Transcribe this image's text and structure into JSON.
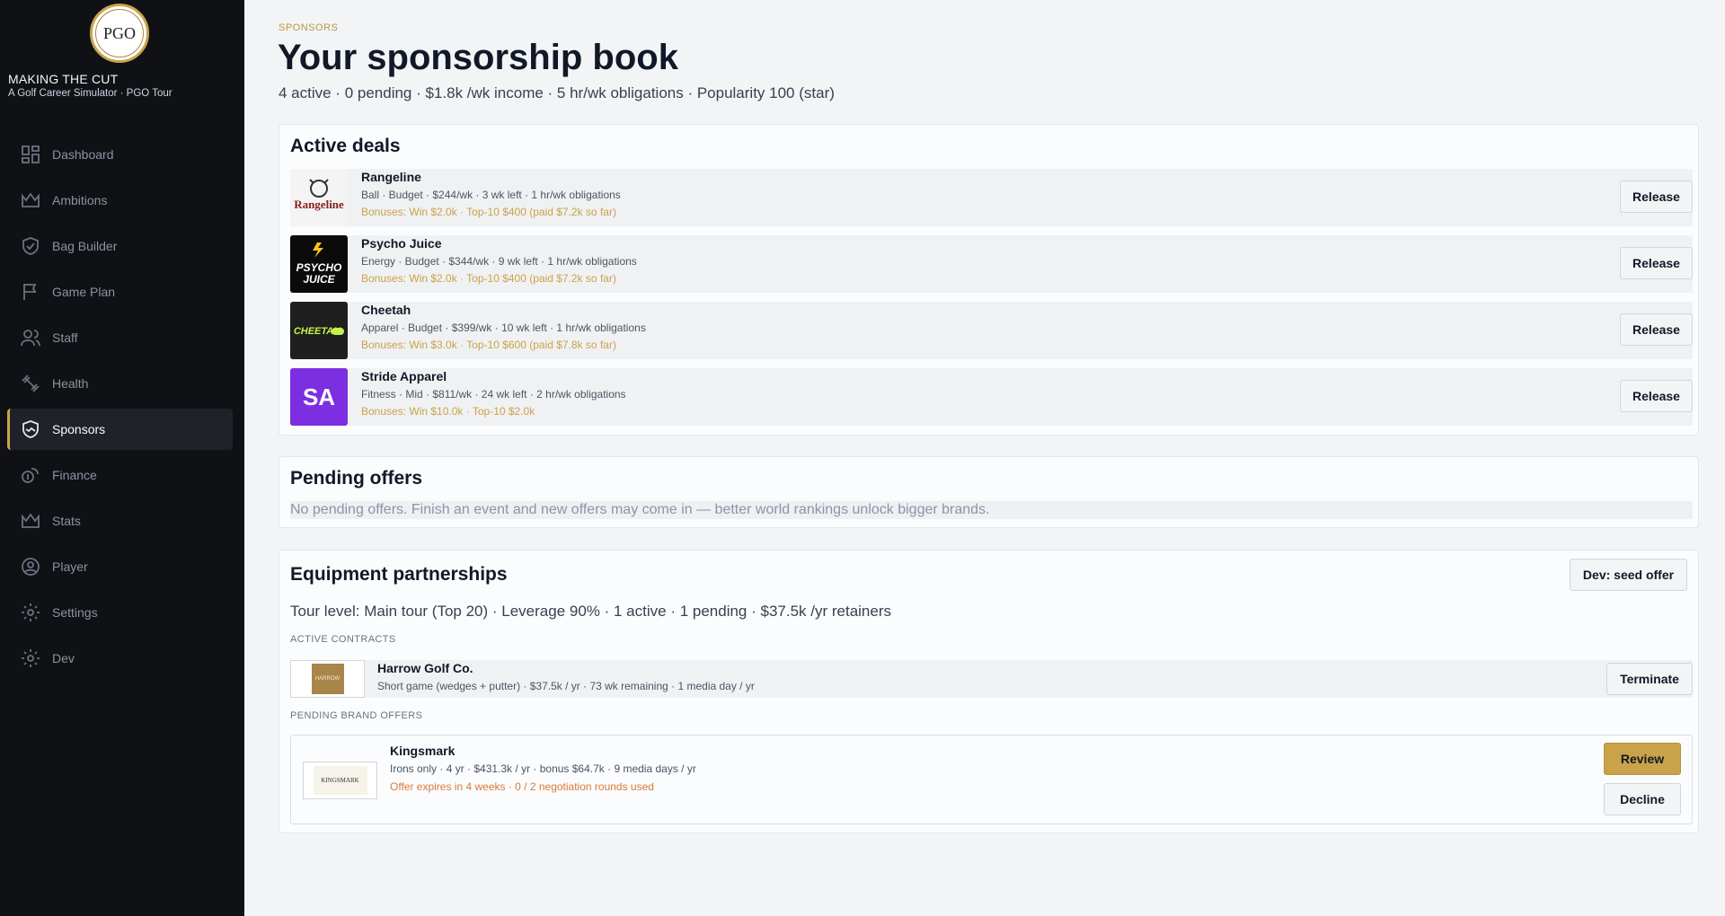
{
  "brand": {
    "logo_text": "PGO",
    "title": "MAKING THE CUT",
    "subtitle": "A Golf Career Simulator · PGO Tour"
  },
  "nav": [
    {
      "label": "Dashboard",
      "icon": "dashboard-icon"
    },
    {
      "label": "Ambitions",
      "icon": "crown-icon"
    },
    {
      "label": "Bag Builder",
      "icon": "shield-icon"
    },
    {
      "label": "Game Plan",
      "icon": "flag-icon"
    },
    {
      "label": "Staff",
      "icon": "users-icon"
    },
    {
      "label": "Health",
      "icon": "dumbbell-icon"
    },
    {
      "label": "Sponsors",
      "icon": "handshake-icon",
      "active": true
    },
    {
      "label": "Finance",
      "icon": "coins-icon"
    },
    {
      "label": "Stats",
      "icon": "crown-icon"
    },
    {
      "label": "Player",
      "icon": "user-circle-icon"
    },
    {
      "label": "Settings",
      "icon": "gear-icon"
    },
    {
      "label": "Dev",
      "icon": "gear-icon"
    }
  ],
  "header": {
    "eyebrow": "SPONSORS",
    "title": "Your sponsorship book",
    "summary": "4 active · 0 pending · $1.8k /wk income · 5 hr/wk obligations · Popularity 100 (star)"
  },
  "active_deals": {
    "title": "Active deals",
    "release_label": "Release",
    "deals": [
      {
        "name": "Rangeline",
        "logo_text": "Rangeline",
        "meta": "Ball · Budget · $244/wk · 3 wk left · 1 hr/wk obligations",
        "bonus": "Bonuses: Win $2.0k · Top-10 $400  (paid $7.2k so far)"
      },
      {
        "name": "Psycho Juice",
        "logo_text": "PSYCHO JUICE",
        "meta": "Energy · Budget · $344/wk · 9 wk left · 1 hr/wk obligations",
        "bonus": "Bonuses: Win $2.0k · Top-10 $400  (paid $7.2k so far)"
      },
      {
        "name": "Cheetah",
        "logo_text": "CHEETAH",
        "meta": "Apparel · Budget · $399/wk · 10 wk left · 1 hr/wk obligations",
        "bonus": "Bonuses: Win $3.0k · Top-10 $600  (paid $7.8k so far)"
      },
      {
        "name": "Stride Apparel",
        "logo_text": "SA",
        "meta": "Fitness · Mid · $811/wk · 24 wk left · 2 hr/wk obligations",
        "bonus": "Bonuses: Win $10.0k · Top-10 $2.0k"
      }
    ]
  },
  "pending_offers": {
    "title": "Pending offers",
    "empty_message": "No pending offers. Finish an event and new offers may come in — better world rankings unlock bigger brands."
  },
  "equipment": {
    "title": "Equipment partnerships",
    "dev_button": "Dev: seed offer",
    "summary": "Tour level: Main tour (Top 20) · Leverage 90% · 1 active · 1 pending · $37.5k /yr retainers",
    "active_label": "ACTIVE CONTRACTS",
    "contract": {
      "name": "Harrow Golf Co.",
      "logo_text": "HARROW",
      "meta": "Short game (wedges + putter) · $37.5k / yr · 73 wk remaining · 1 media day / yr",
      "terminate_label": "Terminate"
    },
    "pending_label": "PENDING BRAND OFFERS",
    "offer": {
      "name": "Kingsmark",
      "logo_text": "KINGSMARK",
      "meta": "Irons only · 4 yr · $431.3k / yr · bonus $64.7k · 9 media days / yr",
      "expiry": "Offer expires in 4 weeks · 0 / 2 negotiation rounds used",
      "review_label": "Review",
      "decline_label": "Decline"
    }
  },
  "colors": {
    "accent": "#c9a54a",
    "sidebar_bg": "#0f1115",
    "bonus_text": "#c9a24a",
    "expiry_text": "#d97a36",
    "review_bg": "#c9a24a"
  }
}
